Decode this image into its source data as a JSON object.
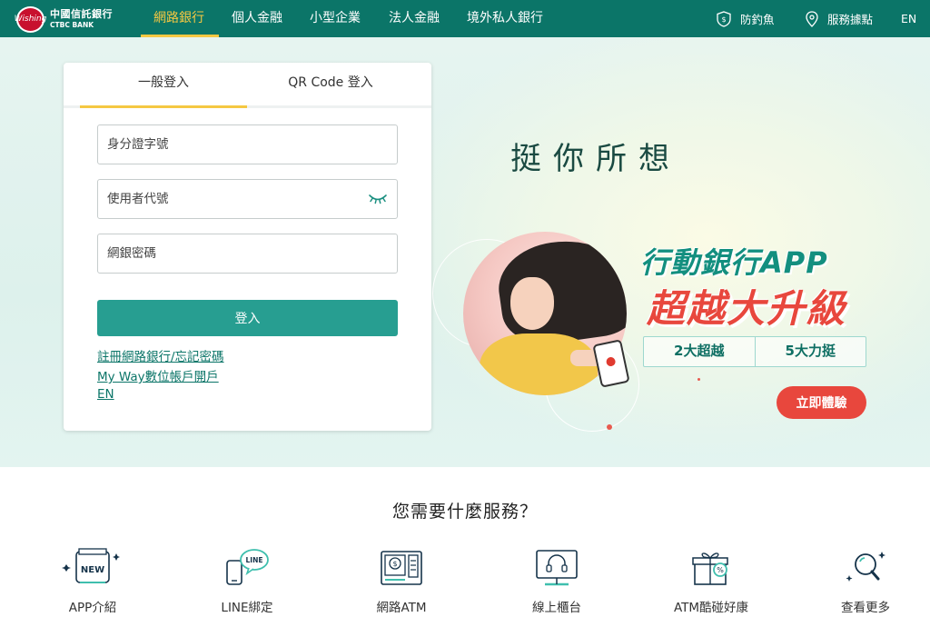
{
  "brand": {
    "name_zh": "中國信託銀行",
    "name_en": "CTBC BANK",
    "logo_mark": "Wishing"
  },
  "nav": {
    "items": [
      {
        "label": "網路銀行",
        "active": true
      },
      {
        "label": "個人金融"
      },
      {
        "label": "小型企業"
      },
      {
        "label": "法人金融"
      },
      {
        "label": "境外私人銀行"
      }
    ],
    "right": [
      {
        "label": "防釣魚",
        "icon": "shield-icon"
      },
      {
        "label": "服務據點",
        "icon": "location-pin-icon"
      },
      {
        "label": "EN"
      }
    ]
  },
  "login": {
    "tabs": [
      {
        "label": "一般登入",
        "active": true
      },
      {
        "label": "QR Code 登入"
      }
    ],
    "fields": [
      {
        "placeholder": "身分證字號"
      },
      {
        "placeholder": "使用者代號",
        "icon": "eye-closed-icon"
      },
      {
        "placeholder": "網銀密碼"
      }
    ],
    "submit_label": "登入",
    "links": [
      "註冊網路銀行/忘記密碼",
      "My Way數位帳戶開戶",
      "EN"
    ]
  },
  "hero": {
    "slogan": "挺你所想",
    "promo_line1": "行動銀行APP",
    "promo_line2": "超越大升級",
    "pills": [
      "2大超越",
      "5大力挺"
    ],
    "cta_label": "立即體驗"
  },
  "services": {
    "title": "您需要什麼服務？",
    "items": [
      {
        "label": "APP介紹",
        "icon": "new-badge-icon",
        "badge": "NEW"
      },
      {
        "label": "LINE綁定",
        "icon": "line-phone-icon",
        "badge": "LINE"
      },
      {
        "label": "網路ATM",
        "icon": "atm-icon"
      },
      {
        "label": "線上櫃台",
        "icon": "headset-monitor-icon"
      },
      {
        "label": "ATM酷碰好康",
        "icon": "gift-box-icon"
      },
      {
        "label": "查看更多",
        "icon": "magnifier-icon"
      }
    ]
  },
  "colors": {
    "nav_bg": "#0b7568",
    "accent_yellow": "#f5c842",
    "primary_teal": "#279e91",
    "promo_red": "#e8473d"
  }
}
